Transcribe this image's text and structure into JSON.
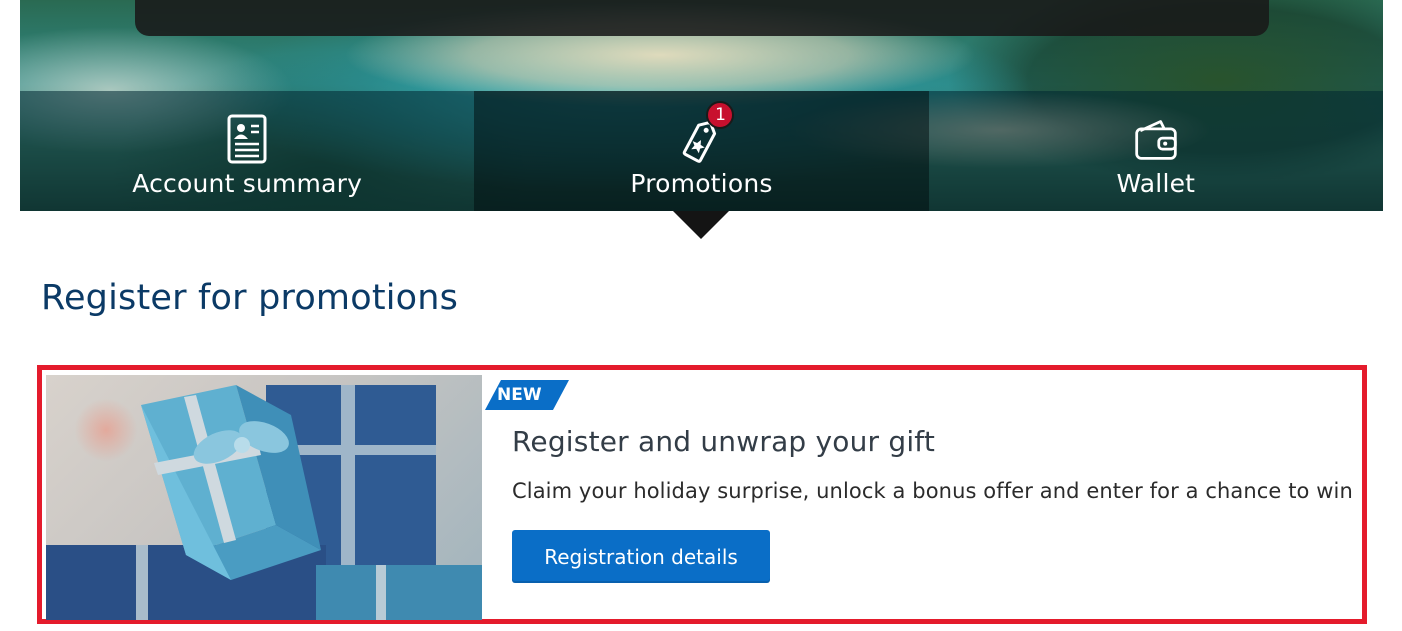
{
  "nav": {
    "tabs": [
      {
        "label": "Account summary",
        "icon": "account-summary-icon",
        "active": false
      },
      {
        "label": "Promotions",
        "icon": "promotion-tag-icon",
        "active": true,
        "badge": "1"
      },
      {
        "label": "Wallet",
        "icon": "wallet-icon",
        "active": false
      }
    ]
  },
  "section": {
    "title": "Register for promotions"
  },
  "promo": {
    "tag": "NEW",
    "title": "Register and unwrap your gift",
    "description": "Claim your holiday surprise, unlock a bonus offer and enter for a chance to win",
    "button_label": "Registration details",
    "image": "gift-boxes-image"
  },
  "colors": {
    "accent_blue": "#0a6ec7",
    "heading_blue": "#0b3a66",
    "highlight_red": "#e41b2c",
    "badge_red": "#c8102e"
  }
}
